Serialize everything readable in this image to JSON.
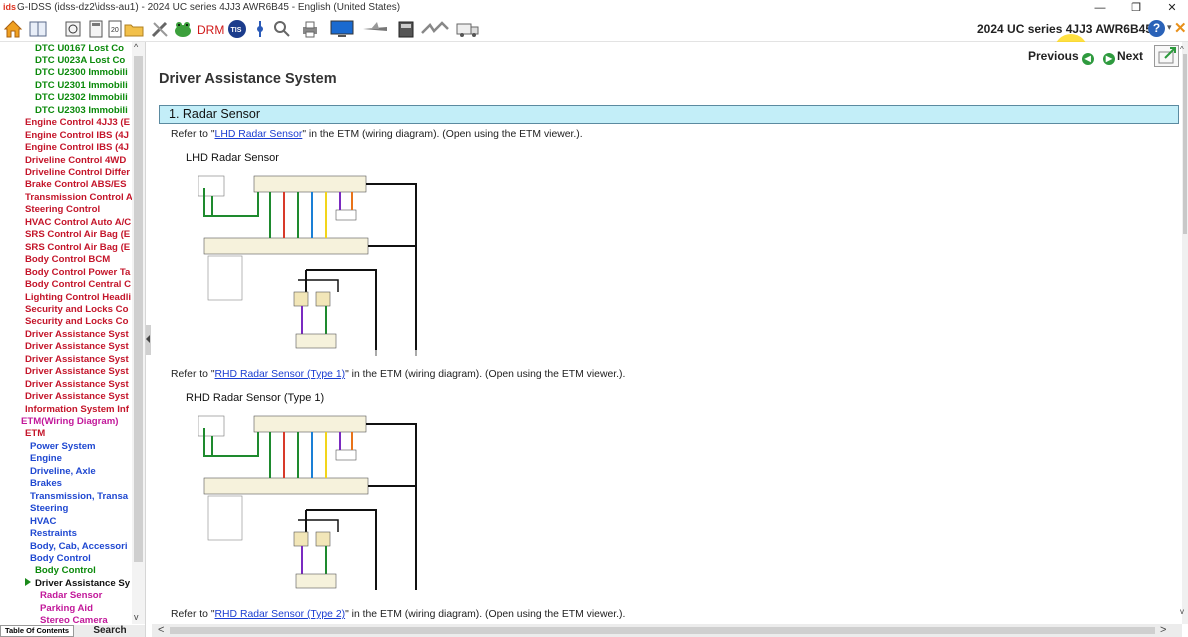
{
  "window": {
    "logo_text": "ids",
    "title": "G-IDSS (idss-dz2\\idss-au1) - 2024 UC series 4JJ3 AWR6B45 - English (United States)",
    "minimize": "—",
    "maximize": "❐",
    "close": "✕"
  },
  "toolbar": {
    "drm_label": "DRM",
    "tis_label": "TIS",
    "vehicle_label": "2024 UC series 4JJ3 AWR6B45",
    "help_label": "?",
    "help_arrow": "▾"
  },
  "sidebar": {
    "items": [
      {
        "label": "DTC U0167 Lost Co",
        "color": "#0b8a0b"
      },
      {
        "label": "DTC U023A Lost Co",
        "color": "#0b8a0b"
      },
      {
        "label": "DTC U2300 Immobili",
        "color": "#0b8a0b"
      },
      {
        "label": "DTC U2301 Immobili",
        "color": "#0b8a0b"
      },
      {
        "label": "DTC U2302 Immobili",
        "color": "#0b8a0b"
      },
      {
        "label": "DTC U2303 Immobili",
        "color": "#0b8a0b"
      },
      {
        "label": "Engine Control 4JJ3 (E",
        "color": "#c4152a"
      },
      {
        "label": "Engine Control IBS (4J",
        "color": "#c4152a"
      },
      {
        "label": "Engine Control IBS (4J",
        "color": "#c4152a"
      },
      {
        "label": "Driveline Control 4WD",
        "color": "#c4152a"
      },
      {
        "label": "Driveline Control Differ",
        "color": "#c4152a"
      },
      {
        "label": "Brake Control ABS/ES",
        "color": "#c4152a"
      },
      {
        "label": "Transmission Control A",
        "color": "#c4152a"
      },
      {
        "label": "Steering Control",
        "color": "#c4152a"
      },
      {
        "label": "HVAC Control Auto A/C",
        "color": "#c4152a"
      },
      {
        "label": "SRS Control Air Bag (E",
        "color": "#c4152a"
      },
      {
        "label": "SRS Control Air Bag (E",
        "color": "#c4152a"
      },
      {
        "label": "Body Control BCM",
        "color": "#c4152a"
      },
      {
        "label": "Body Control Power Ta",
        "color": "#c4152a"
      },
      {
        "label": "Body Control Central C",
        "color": "#c4152a"
      },
      {
        "label": "Lighting Control Headli",
        "color": "#c4152a"
      },
      {
        "label": "Security and Locks Co",
        "color": "#c4152a"
      },
      {
        "label": "Security and Locks Co",
        "color": "#c4152a"
      },
      {
        "label": "Driver Assistance Syst",
        "color": "#c4152a"
      },
      {
        "label": "Driver Assistance Syst",
        "color": "#c4152a"
      },
      {
        "label": "Driver Assistance Syst",
        "color": "#c4152a"
      },
      {
        "label": "Driver Assistance Syst",
        "color": "#c4152a"
      },
      {
        "label": "Driver Assistance Syst",
        "color": "#c4152a"
      },
      {
        "label": "Driver Assistance Syst",
        "color": "#c4152a"
      },
      {
        "label": "Information System Inf",
        "color": "#c4152a"
      },
      {
        "label": "ETM(Wiring Diagram)",
        "color": "#c2189a"
      },
      {
        "label": "ETM",
        "color": "#c4152a"
      },
      {
        "label": "Power System",
        "color": "#1f48d1"
      },
      {
        "label": "Engine",
        "color": "#1f48d1"
      },
      {
        "label": "Driveline, Axle",
        "color": "#1f48d1"
      },
      {
        "label": "Brakes",
        "color": "#1f48d1"
      },
      {
        "label": "Transmission, Transa",
        "color": "#1f48d1"
      },
      {
        "label": "Steering",
        "color": "#1f48d1"
      },
      {
        "label": "HVAC",
        "color": "#1f48d1"
      },
      {
        "label": "Restraints",
        "color": "#1f48d1"
      },
      {
        "label": "Body, Cab, Accessori",
        "color": "#1f48d1"
      },
      {
        "label": "Body Control",
        "color": "#1f48d1"
      },
      {
        "label": "Body Control",
        "color": "#0b8a0b"
      },
      {
        "label": "Driver Assistance Sy",
        "color": "#111111"
      },
      {
        "label": "Radar Sensor",
        "color": "#c2189a"
      },
      {
        "label": "Parking Aid",
        "color": "#c2189a"
      },
      {
        "label": "Stereo Camera",
        "color": "#c2189a"
      }
    ],
    "tab_toc": "Table Of Contents",
    "tab_search": "Search",
    "scroll_up": "^",
    "scroll_down": "v"
  },
  "content": {
    "title": "Driver Assistance System",
    "prev_label": "Previous",
    "next_label": "Next",
    "section_title": "1. Radar Sensor",
    "refs": [
      {
        "before": "Refer to \"",
        "link": "LHD Radar Sensor",
        "after": "\" in the ETM (wiring diagram). (Open using the ETM viewer.)."
      },
      {
        "before": "Refer to \"",
        "link": "RHD Radar Sensor (Type 1)",
        "after": "\" in the ETM (wiring diagram). (Open using the ETM viewer.)."
      },
      {
        "before": "Refer to \"",
        "link": "RHD Radar Sensor (Type 2)",
        "after": "\" in the ETM (wiring diagram). (Open using the ETM viewer.)."
      }
    ],
    "figures": [
      {
        "title": "LHD Radar Sensor"
      },
      {
        "title": "RHD Radar Sensor (Type 1)"
      }
    ]
  },
  "colors": {
    "section_bar": "#c3eef8",
    "link": "#1a3dd1",
    "wire_green": "#1e8a2e",
    "wire_red": "#d83a2a",
    "wire_blue": "#1a7fd6",
    "wire_yellow": "#f2d51a",
    "wire_purple": "#7a2ac0",
    "wire_orange": "#e8731a"
  }
}
